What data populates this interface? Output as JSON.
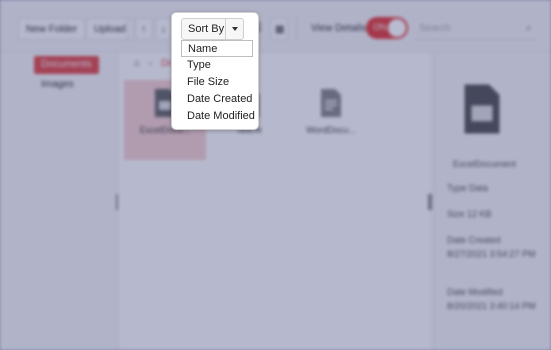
{
  "toolbar": {
    "new_folder": "New Folder",
    "upload": "Upload",
    "view_details": "View Details",
    "toggle_state": "ON",
    "search_placeholder": "Search"
  },
  "sort": {
    "label": "Sort By",
    "options": [
      "Name",
      "Type",
      "File Size",
      "Date Created",
      "Date Modified"
    ]
  },
  "nav": {
    "items": [
      "Documents",
      "Images"
    ]
  },
  "breadcrumb": {
    "current": "Do"
  },
  "files": [
    {
      "name": "ExcelDocu..."
    },
    {
      "name": "TextTe"
    },
    {
      "name": "WordDocu..."
    }
  ],
  "details": {
    "name": "ExcelDocument",
    "type": "Type Data",
    "size": "Size 12 KB",
    "created_label": "Date Created",
    "created_value": "8/27/2021 3:54:27 PM",
    "modified_label": "Date Modified",
    "modified_value": "8/20/2021 3:40:14 PM"
  },
  "colors": {
    "accent": "#e04a4a",
    "overlay": "#a7abc2"
  }
}
